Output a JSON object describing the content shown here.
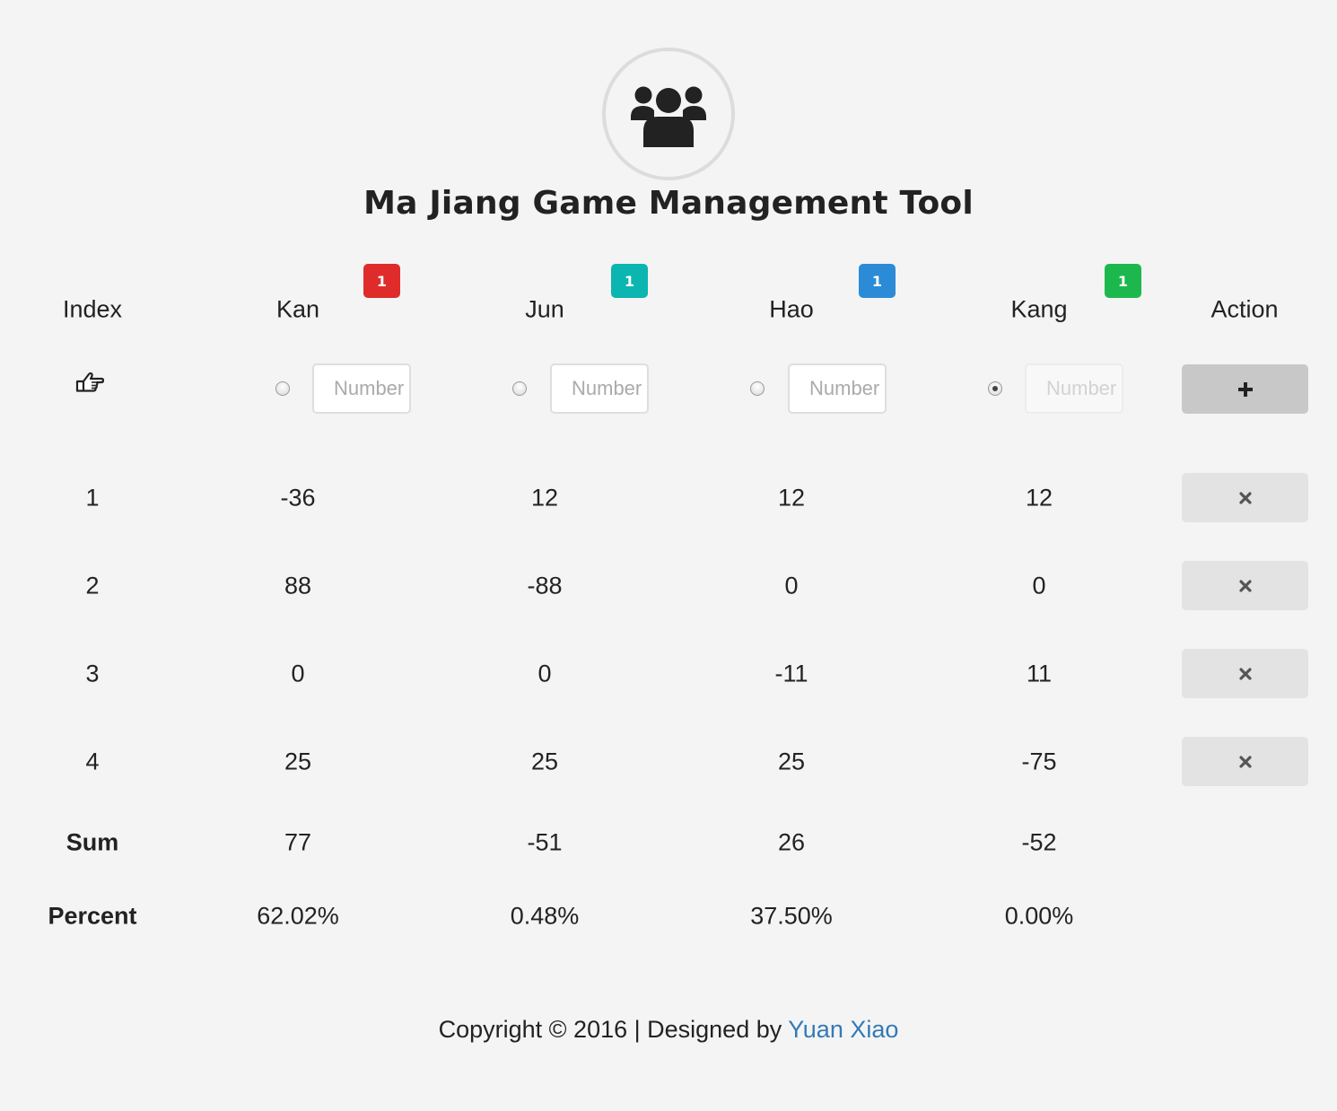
{
  "title": "Ma Jiang Game Management Tool",
  "logo_icon": "users-group-icon",
  "header": {
    "index_label": "Index",
    "action_label": "Action",
    "players": [
      {
        "name": "Kan",
        "badge": "1",
        "badge_color": "#e02b2b"
      },
      {
        "name": "Jun",
        "badge": "1",
        "badge_color": "#0bb5b0"
      },
      {
        "name": "Hao",
        "badge": "1",
        "badge_color": "#2b8bd6"
      },
      {
        "name": "Kang",
        "badge": "1",
        "badge_color": "#1db84d"
      }
    ]
  },
  "entry": {
    "pointer_icon": "hand-pointing-right-icon",
    "placeholder": "Number",
    "selected_player_index": 3,
    "add_button_icon": "plus-icon"
  },
  "rounds": [
    {
      "index": "1",
      "scores": [
        "-36",
        "12",
        "12",
        "12"
      ]
    },
    {
      "index": "2",
      "scores": [
        "88",
        "-88",
        "0",
        "0"
      ]
    },
    {
      "index": "3",
      "scores": [
        "0",
        "0",
        "-11",
        "11"
      ]
    },
    {
      "index": "4",
      "scores": [
        "25",
        "25",
        "25",
        "-75"
      ]
    }
  ],
  "delete_button_icon": "close-icon",
  "sum": {
    "label": "Sum",
    "values": [
      "77",
      "-51",
      "26",
      "-52"
    ]
  },
  "percent": {
    "label": "Percent",
    "values": [
      "62.02%",
      "0.48%",
      "37.50%",
      "0.00%"
    ]
  },
  "footer": {
    "text": "Copyright © 2016 | Designed by ",
    "link_text": "Yuan Xiao"
  },
  "colors": {
    "background": "#f4f4f4",
    "link": "#337ab7",
    "add_button": "#c8c8c8",
    "delete_button": "#e3e3e3"
  }
}
